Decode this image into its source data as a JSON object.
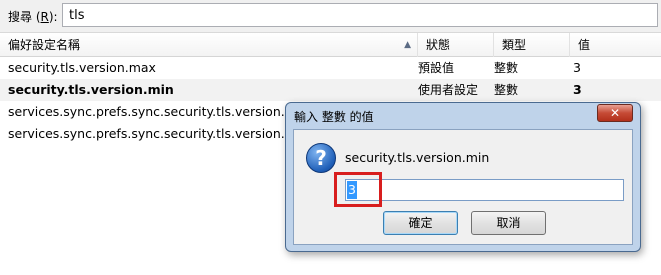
{
  "search": {
    "label_prefix": "搜尋 (",
    "label_key": "R",
    "label_suffix": "):",
    "value": "tls"
  },
  "columns": {
    "name": "偏好設定名稱",
    "status": "狀態",
    "type": "類型",
    "value": "值"
  },
  "rows": [
    {
      "name": "security.tls.version.max",
      "status": "預設值",
      "type": "整數",
      "value": "3"
    },
    {
      "name": "security.tls.version.min",
      "status": "使用者設定",
      "type": "整數",
      "value": "3"
    },
    {
      "name": "services.sync.prefs.sync.security.tls.version.max",
      "status": "",
      "type": "",
      "value": ""
    },
    {
      "name": "services.sync.prefs.sync.security.tls.version.min",
      "status": "",
      "type": "",
      "value": ""
    }
  ],
  "dialog": {
    "title": "輸入 整數 的值",
    "close_glyph": "✕",
    "icon_glyph": "?",
    "message": "security.tls.version.min",
    "input_value": "3",
    "ok_label": "確定",
    "cancel_label": "取消"
  },
  "colors": {
    "highlight_border": "#d81e1e",
    "selection": "#3399ff",
    "dialog_frame": "#bfd3ea"
  },
  "icons": {
    "sort": "sort-ascending-icon",
    "help": "question-icon",
    "close": "close-icon"
  }
}
